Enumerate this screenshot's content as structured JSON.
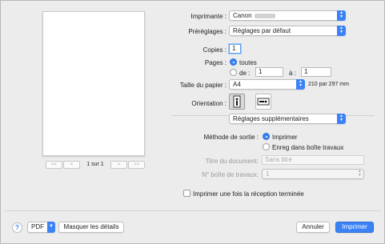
{
  "pager": {
    "first": "<<",
    "prev": "<",
    "status": "1 sur 1",
    "next": ">",
    "last": ">>"
  },
  "printer": {
    "label": "Imprimante :",
    "value": "Canon"
  },
  "presets": {
    "label": "Préréglages :",
    "value": "Réglages par défaut"
  },
  "copies": {
    "label": "Copies :",
    "value": "1"
  },
  "pages": {
    "label": "Pages :",
    "all_label": "toutes",
    "from_label": "de :",
    "from_value": "1",
    "to_label": "à :",
    "to_value": "1"
  },
  "paper": {
    "label": "Taille du papier :",
    "value": "A4",
    "dimensions": "210 par 297 mm"
  },
  "orientation": {
    "label": "Orientation :"
  },
  "section_popup": {
    "value": "Réglages supplémentaires"
  },
  "output": {
    "label": "Méthode de sortie :",
    "print_label": "Imprimer",
    "save_label": "Enreg dans boîte travaux"
  },
  "doc_title": {
    "label": "Titre du document:",
    "placeholder": "Sans titre"
  },
  "box_no": {
    "label": "N° boîte de travaux:",
    "value": "1"
  },
  "once_checkbox": {
    "label": "Imprimer une fois la réception terminée"
  },
  "bottom": {
    "help": "?",
    "pdf": "PDF",
    "details": "Masquer les détails",
    "cancel": "Annuler",
    "print": "Imprimer"
  },
  "colors": {
    "accent": "#3b82f6"
  }
}
